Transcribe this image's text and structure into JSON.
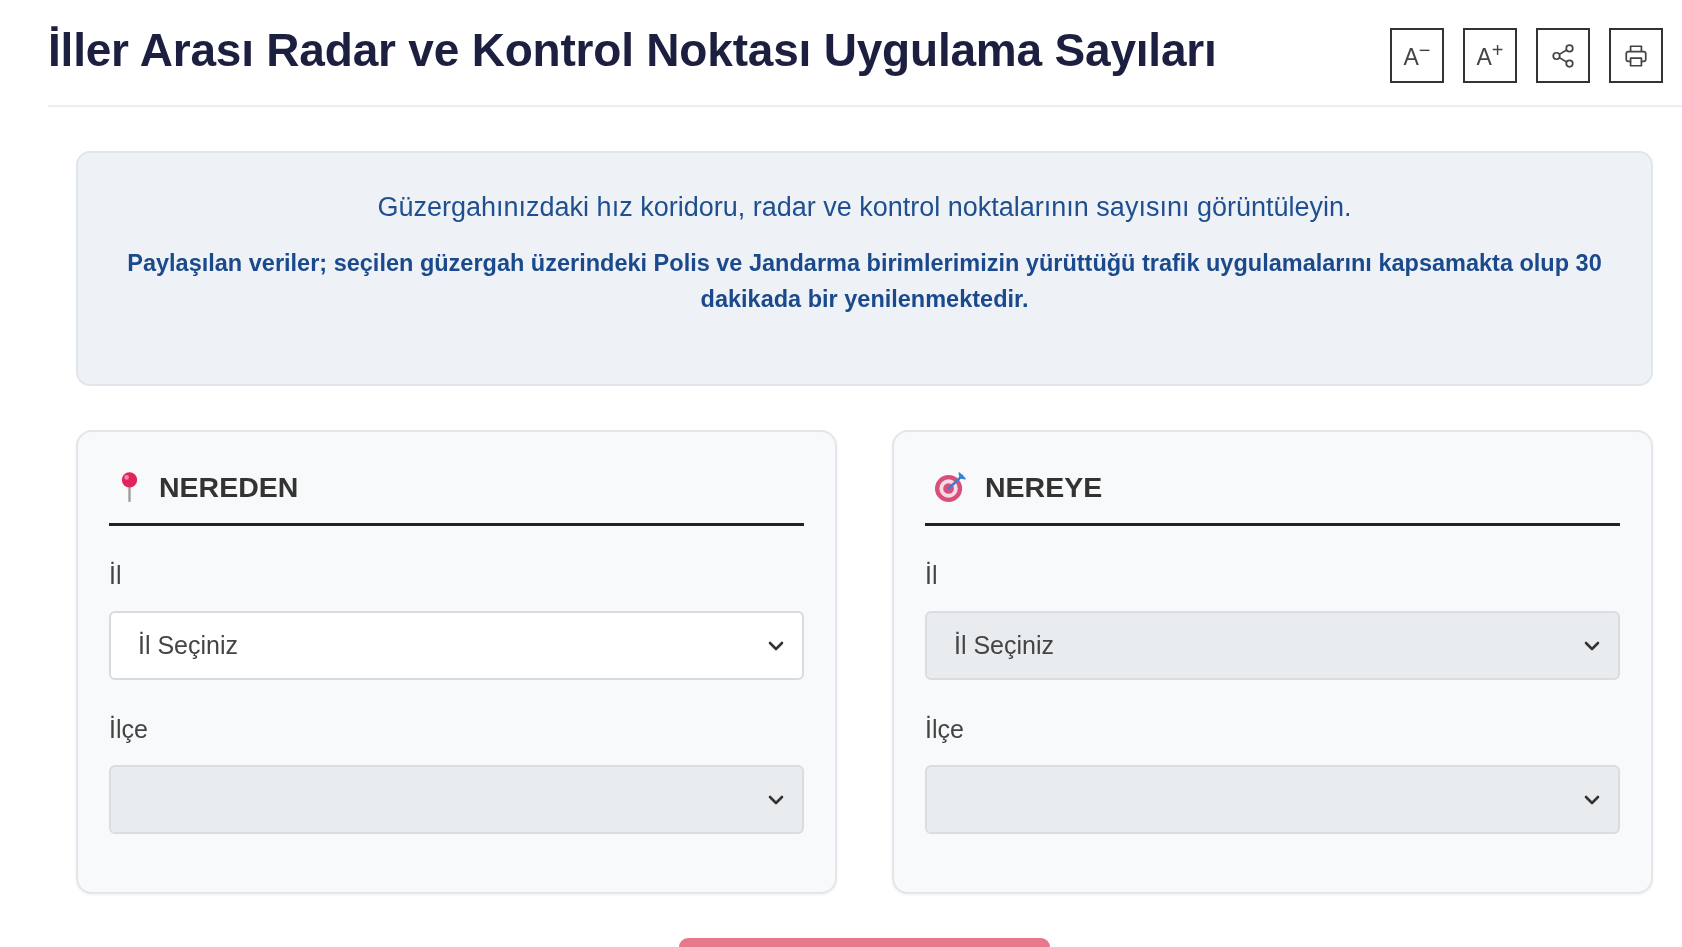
{
  "header": {
    "title": "İller Arası Radar ve Kontrol Noktası Uygulama Sayıları",
    "tools": [
      {
        "kind": "text",
        "label": "A$^{−}$"
      },
      {
        "kind": "text",
        "label": "A$^{+}$"
      },
      {
        "kind": "share"
      },
      {
        "kind": "print"
      }
    ]
  },
  "info": {
    "lead": "Güzergahınızdaki hız koridoru, radar ve kontrol noktalarının sayısını görüntüleyin.",
    "note": "Paylaşılan veriler; seçilen güzergah üzerindeki Polis ve Jandarma birimlerimizin yürüttüğü trafik uygulamalarını kapsamakta olup 30 dakikada bir yenilenmektedir."
  },
  "panels": [
    {
      "kind": "origin",
      "title": "NEREDEN",
      "fields": [
        {
          "label": "İl",
          "value": "İl Seçiniz",
          "disabled": false
        },
        {
          "label": "İlçe",
          "disabled": true
        }
      ]
    },
    {
      "kind": "destination",
      "title": "NEREYE",
      "fields": [
        {
          "label": "İl",
          "value": "İl Seçiniz",
          "disabled": true
        },
        {
          "label": "İlçe",
          "disabled": true
        }
      ]
    }
  ]
}
